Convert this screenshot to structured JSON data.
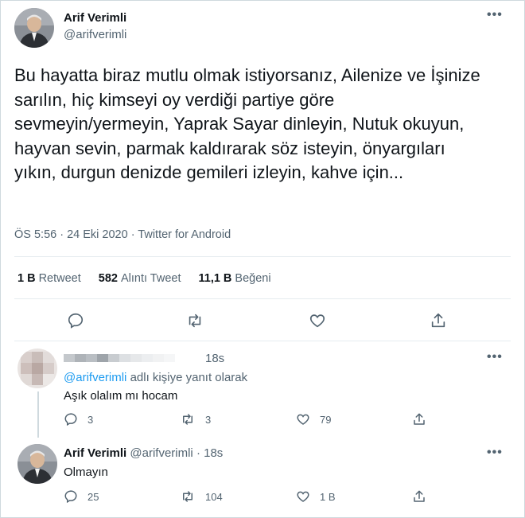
{
  "main_tweet": {
    "author_name": "Arif Verimli",
    "author_handle": "@arifverimli",
    "text": "Bu hayatta biraz mutlu olmak istiyorsanız, Ailenize ve İşinize sarılın, hiç kimseyi oy verdiği partiye göre sevmeyin/yermeyin, Yaprak Sayar dinleyin, Nutuk okuyun, hayvan sevin, parmak kaldırarak söz isteyin, önyargıları yıkın, durgun denizde gemileri izleyin, kahve için...",
    "meta": "ÖS 5:56 · 24 Eki 2020 · Twitter for Android",
    "stats": {
      "retweets_value": "1 B",
      "retweets_label": "Retweet",
      "quotes_value": "582",
      "quotes_label": "Alıntı Tweet",
      "likes_value": "11,1 B",
      "likes_label": "Beğeni"
    },
    "actions": [
      "reply-icon",
      "retweet-icon",
      "like-icon",
      "share-icon"
    ]
  },
  "reply1": {
    "time": "18s",
    "reply_to_handle": "@arifverimli",
    "reply_to_suffix": "adlı kişiye yanıt olarak",
    "text": "Aşık olalım mı hocam",
    "replies": "3",
    "retweets": "3",
    "likes": "79"
  },
  "reply2": {
    "author_name": "Arif Verimli",
    "author_handle": "@arifverimli",
    "dot": "·",
    "time": "18s",
    "text": "Olmayın",
    "replies": "25",
    "retweets": "104",
    "likes": "1 B"
  },
  "icons": {
    "more": "more-dots-icon"
  },
  "colors": {
    "text": "#0f1419",
    "secondary": "#536471",
    "link": "#1d9bf0",
    "border": "#cfd9de"
  }
}
